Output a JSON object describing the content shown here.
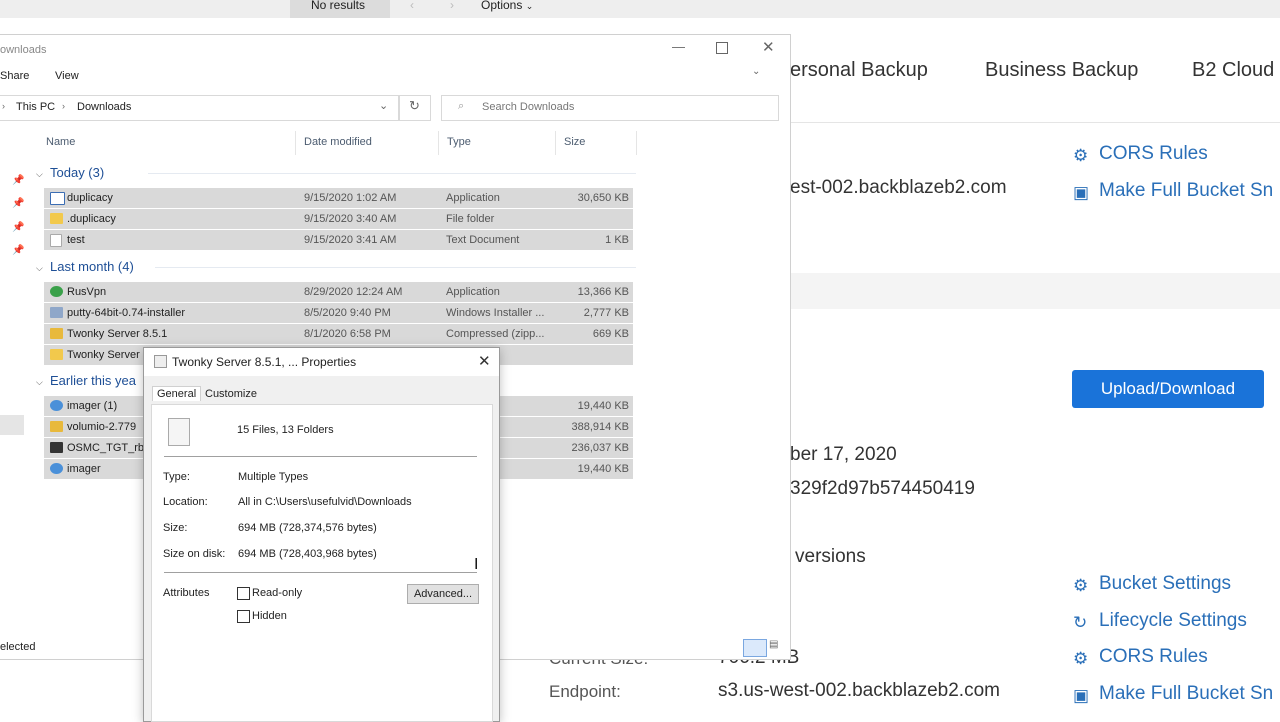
{
  "topbar": {
    "no_results": "No results",
    "options": "Options"
  },
  "web": {
    "tabs": [
      "ersonal Backup",
      "Business Backup",
      "B2 Cloud"
    ],
    "links_top": [
      {
        "label": "CORS Rules",
        "icon": "gear-icon"
      },
      {
        "label": "Make Full Bucket Sn",
        "icon": "snapshot-icon"
      }
    ],
    "endpoint_top": "est-002.backblazeb2.com",
    "upload_button": "Upload/Download",
    "date_partial": "ber 17, 2020",
    "id_partial": "329f2d97b574450419",
    "versions_partial": "versions",
    "links_bottom": [
      {
        "label": "Bucket Settings",
        "icon": "gear-icon"
      },
      {
        "label": "Lifecycle Settings",
        "icon": "lifecycle-icon"
      },
      {
        "label": "CORS Rules",
        "icon": "gear-icon"
      },
      {
        "label": "Make Full Bucket Sn",
        "icon": "snapshot-icon"
      }
    ],
    "current_size_label": "Current Size:",
    "current_size_value": "706.2 MB",
    "endpoint_label": "Endpoint:",
    "endpoint_value": "s3.us-west-002.backblazeb2.com",
    "colors": {
      "link": "#2a6fb8",
      "button": "#1a73d9"
    }
  },
  "explorer": {
    "title": "ownloads",
    "ribbon": [
      "Share",
      "View"
    ],
    "breadcrumb": [
      "This PC",
      "Downloads"
    ],
    "search_placeholder": "Search Downloads",
    "columns": [
      "Name",
      "Date modified",
      "Type",
      "Size"
    ],
    "groups": [
      {
        "label": "Today (3)",
        "rows": [
          {
            "name": "duplicacy",
            "date": "9/15/2020 1:02 AM",
            "type": "Application",
            "size": "30,650 KB",
            "icon": "app-icon"
          },
          {
            "name": ".duplicacy",
            "date": "9/15/2020 3:40 AM",
            "type": "File folder",
            "size": "",
            "icon": "folder-icon"
          },
          {
            "name": "test",
            "date": "9/15/2020 3:41 AM",
            "type": "Text Document",
            "size": "1 KB",
            "icon": "text-file-icon"
          }
        ]
      },
      {
        "label": "Last month (4)",
        "rows": [
          {
            "name": "RusVpn",
            "date": "8/29/2020 12:24 AM",
            "type": "Application",
            "size": "13,366 KB",
            "icon": "vpn-app-icon"
          },
          {
            "name": "putty-64bit-0.74-installer",
            "date": "8/5/2020 9:40 PM",
            "type": "Windows Installer ...",
            "size": "2,777 KB",
            "icon": "installer-icon"
          },
          {
            "name": "Twonky Server 8.5.1",
            "date": "8/1/2020 6:58 PM",
            "type": "Compressed (zipp...",
            "size": "669 KB",
            "icon": "zip-folder-icon"
          },
          {
            "name": "Twonky Server",
            "date": "",
            "type": "",
            "size": "",
            "icon": "folder-icon"
          }
        ]
      },
      {
        "label": "Earlier this yea",
        "rows": [
          {
            "name": "imager (1)",
            "date": "",
            "type": "n",
            "size": "19,440 KB",
            "icon": "imager-icon"
          },
          {
            "name": "volumio-2.779",
            "date": "",
            "type": "ed (zipp...",
            "size": "388,914 KB",
            "icon": "zip-folder-icon"
          },
          {
            "name": "OSMC_TGT_rb",
            "date": "",
            "type": "",
            "size": "236,037 KB",
            "icon": "archive-icon"
          },
          {
            "name": "imager",
            "date": "",
            "type": "n",
            "size": "19,440 KB",
            "icon": "imager-icon"
          }
        ]
      }
    ],
    "status": "elected"
  },
  "props": {
    "title": "Twonky Server 8.5.1, ... Properties",
    "tabs": [
      "General",
      "Customize"
    ],
    "summary": "15 Files, 13 Folders",
    "type_label": "Type:",
    "type_value": "Multiple Types",
    "location_label": "Location:",
    "location_value": "All in C:\\Users\\usefulvid\\Downloads",
    "size_label": "Size:",
    "size_value": "694 MB (728,374,576 bytes)",
    "disk_label": "Size on disk:",
    "disk_value": "694 MB (728,403,968 bytes)",
    "attributes_label": "Attributes",
    "readonly_label": "Read-only",
    "hidden_label": "Hidden",
    "advanced_label": "Advanced..."
  }
}
